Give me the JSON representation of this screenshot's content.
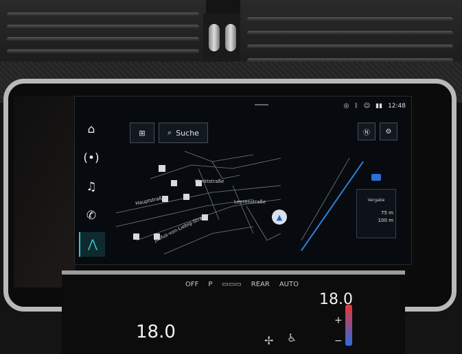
{
  "status": {
    "time": "12:48"
  },
  "top": {
    "search_label": "Suche"
  },
  "map": {
    "streets": [
      "Marktstraße",
      "Hauptstraße",
      "Leerenstraße",
      "Justus-von-Liebig-Straße"
    ],
    "guidance_label": "Vergabe",
    "distances": [
      "75 m",
      "100 m"
    ]
  },
  "climate": {
    "left_temp": "18.0",
    "right_temp": "18.0",
    "buttons": [
      "OFF",
      "P",
      "▭▭▭",
      "REAR",
      "AUTO"
    ]
  },
  "icons": {
    "home": "home-icon",
    "radio": "radio-icon",
    "music": "music-icon",
    "phone": "phone-icon",
    "nav": "navigation-icon",
    "apps": "apps-grid-icon",
    "search": "search-icon",
    "compass": "compass-icon",
    "settings": "gear-icon"
  },
  "colors": {
    "accent": "#37c5cf",
    "position": "#1c62d0"
  }
}
